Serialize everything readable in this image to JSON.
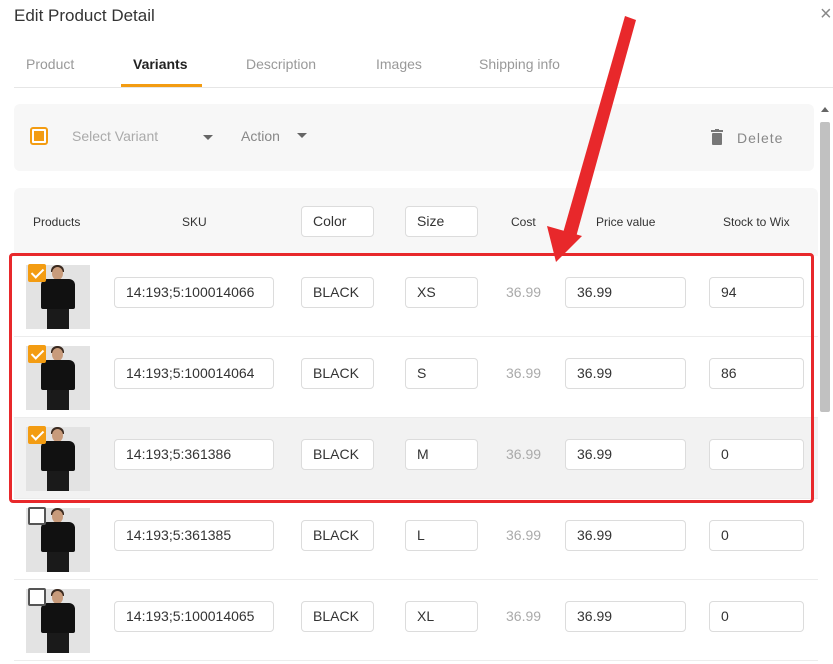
{
  "dialog": {
    "title": "Edit Product Detail",
    "close_glyph": "×"
  },
  "tabs": [
    {
      "label": "Product"
    },
    {
      "label": "Variants"
    },
    {
      "label": "Description"
    },
    {
      "label": "Images"
    },
    {
      "label": "Shipping info"
    }
  ],
  "active_tab": "Variants",
  "toolbar": {
    "select_variant": "Select Variant",
    "action": "Action",
    "delete": "Delete"
  },
  "table": {
    "headers": {
      "products": "Products",
      "sku": "SKU",
      "color": "Color",
      "size": "Size",
      "cost": "Cost",
      "price": "Price value",
      "stock": "Stock to Wix"
    },
    "rows": [
      {
        "checked": true,
        "sku": "14:193;5:100014066",
        "color": "BLACK",
        "size": "XS",
        "cost": "36.99",
        "price": "36.99",
        "stock": "94"
      },
      {
        "checked": true,
        "sku": "14:193;5:100014064",
        "color": "BLACK",
        "size": "S",
        "cost": "36.99",
        "price": "36.99",
        "stock": "86"
      },
      {
        "checked": true,
        "sku": "14:193;5:361386",
        "color": "BLACK",
        "size": "M",
        "cost": "36.99",
        "price": "36.99",
        "stock": "0"
      },
      {
        "checked": false,
        "sku": "14:193;5:361385",
        "color": "BLACK",
        "size": "L",
        "cost": "36.99",
        "price": "36.99",
        "stock": "0"
      },
      {
        "checked": false,
        "sku": "14:193;5:100014065",
        "color": "BLACK",
        "size": "XL",
        "cost": "36.99",
        "price": "36.99",
        "stock": "0"
      }
    ]
  },
  "colors": {
    "accent": "#f39c12",
    "annotation": "#e8282b",
    "highlight_row": "#f2f2f2"
  },
  "icons": {
    "delete": "trash-icon",
    "close": "close-icon"
  }
}
